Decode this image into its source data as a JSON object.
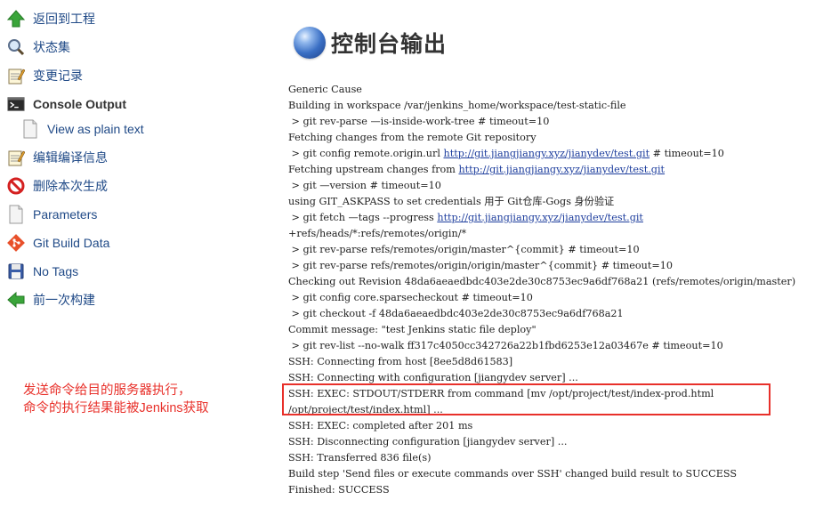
{
  "sidebar": {
    "items": [
      {
        "label": "返回到工程",
        "icon": "up-arrow-icon"
      },
      {
        "label": "状态集",
        "icon": "magnifier-icon"
      },
      {
        "label": "变更记录",
        "icon": "notepad-icon"
      },
      {
        "label": "Console Output",
        "icon": "terminal-icon"
      },
      {
        "label": "View as plain text",
        "icon": "document-icon"
      },
      {
        "label": "编辑编译信息",
        "icon": "notepad-icon"
      },
      {
        "label": "删除本次生成",
        "icon": "no-entry-icon"
      },
      {
        "label": "Parameters",
        "icon": "document-icon"
      },
      {
        "label": "Git Build Data",
        "icon": "git-icon"
      },
      {
        "label": "No Tags",
        "icon": "save-icon"
      },
      {
        "label": "前一次构建",
        "icon": "left-arrow-icon"
      }
    ]
  },
  "annotation": {
    "line1": "发送命令给目的服务器执行，",
    "line2": "命令的执行结果能被Jenkins获取"
  },
  "main": {
    "title": "控制台输出",
    "console_lines": [
      {
        "text": "Generic Cause"
      },
      {
        "text": "Building in workspace /var/jenkins_home/workspace/test-static-file"
      },
      {
        "text": " > git rev-parse —is-inside-work-tree # timeout=10"
      },
      {
        "text": "Fetching changes from the remote Git repository"
      },
      {
        "pre": " > git config remote.origin.url ",
        "link": "http://git.jiangjiangy.xyz/jianydev/test.git",
        "post": " # timeout=10"
      },
      {
        "pre": "Fetching upstream changes from ",
        "link": "http://git.jiangjiangy.xyz/jianydev/test.git",
        "post": ""
      },
      {
        "text": " > git —version # timeout=10"
      },
      {
        "text": "using GIT_ASKPASS to set credentials 用于 Git仓库-Gogs 身份验证"
      },
      {
        "pre": " > git fetch —tags --progress ",
        "link": "http://git.jiangjiangy.xyz/jianydev/test.git",
        "post": ""
      },
      {
        "text": "+refs/heads/*:refs/remotes/origin/*"
      },
      {
        "text": " > git rev-parse refs/remotes/origin/master^{commit} # timeout=10"
      },
      {
        "text": " > git rev-parse refs/remotes/origin/origin/master^{commit} # timeout=10"
      },
      {
        "text": "Checking out Revision 48da6aeaedbdc403e2de30c8753ec9a6df768a21 (refs/remotes/origin/master)"
      },
      {
        "text": " > git config core.sparsecheckout # timeout=10"
      },
      {
        "text": " > git checkout -f 48da6aeaedbdc403e2de30c8753ec9a6df768a21"
      },
      {
        "text": "Commit message: \"test Jenkins static file deploy\""
      },
      {
        "text": " > git rev-list --no-walk ff317c4050cc342726a22b1fbd6253e12a03467e # timeout=10"
      },
      {
        "text": "SSH: Connecting from host [8ee5d8d61583]"
      },
      {
        "text": "SSH: Connecting with configuration [jiangydev server] ..."
      },
      {
        "text": "SSH: EXEC: STDOUT/STDERR from command [mv /opt/project/test/index-prod.html"
      },
      {
        "text": "/opt/project/test/index.html] ..."
      },
      {
        "text": "SSH: EXEC: completed after 201 ms"
      },
      {
        "text": "SSH: Disconnecting configuration [jiangydev server] ..."
      },
      {
        "text": "SSH: Transferred 836 file(s)"
      },
      {
        "text": "Build step 'Send files or execute commands over SSH' changed build result to SUCCESS"
      },
      {
        "text": "Finished: SUCCESS"
      }
    ]
  },
  "colors": {
    "link": "#1f3f9e",
    "annotation": "#e8302a",
    "highlight_border": "#e8302a"
  }
}
